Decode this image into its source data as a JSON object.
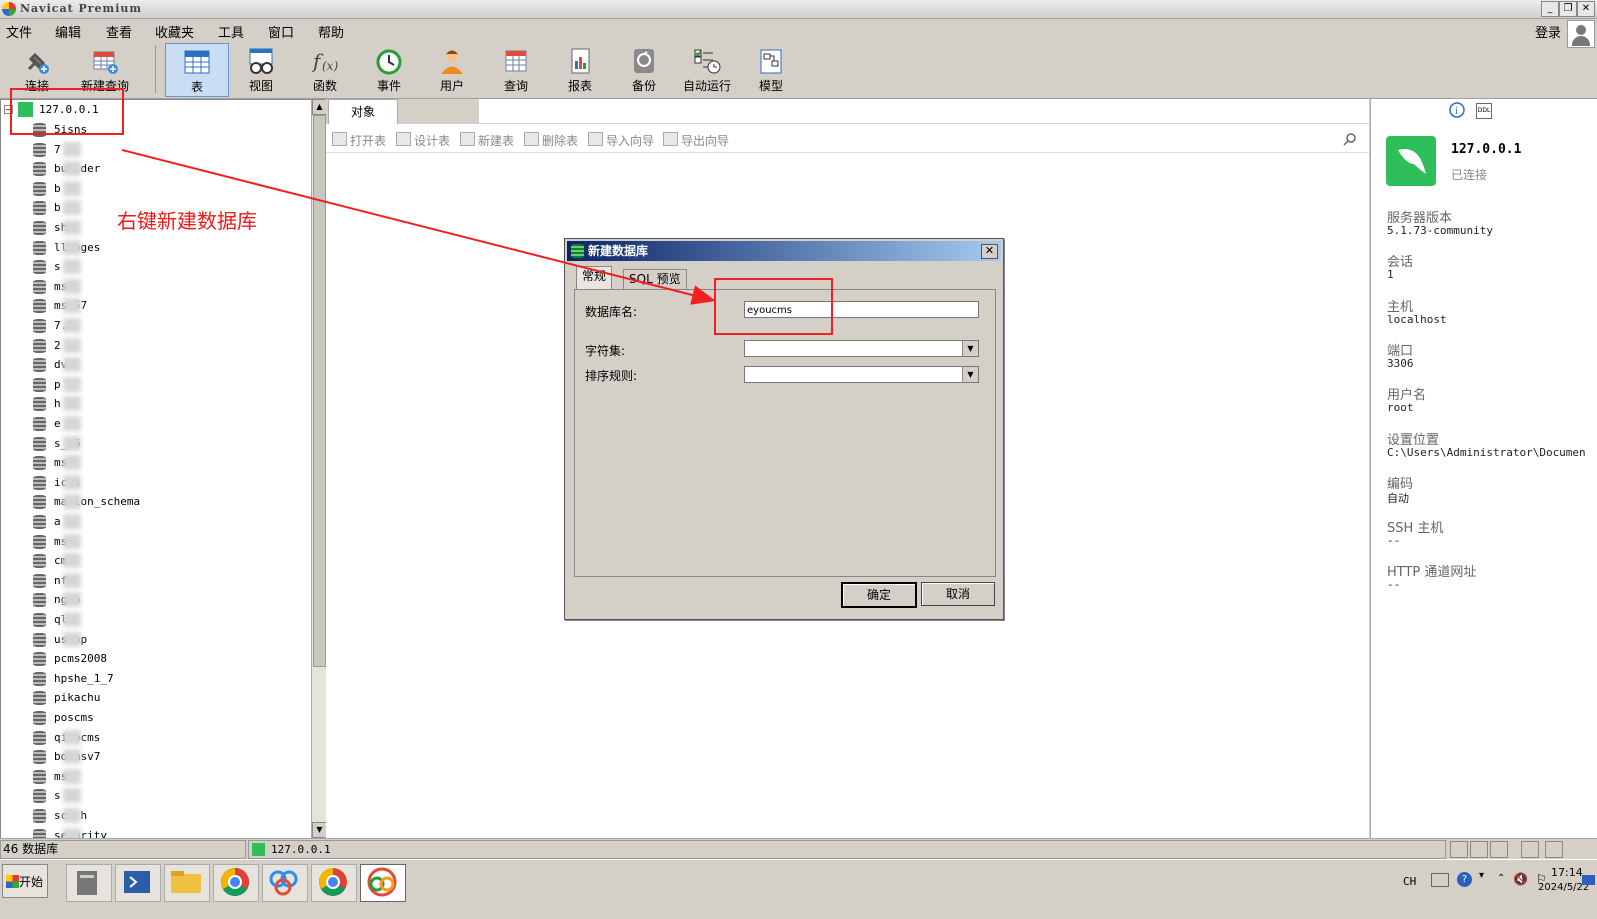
{
  "window": {
    "title": "Navicat Premium"
  },
  "menu": [
    "文件",
    "编辑",
    "查看",
    "收藏夹",
    "工具",
    "窗口",
    "帮助"
  ],
  "login_label": "登录",
  "toolbar": [
    {
      "label": "连接",
      "icon": "plug-icon"
    },
    {
      "label": "新建查询",
      "icon": "new-query-icon"
    },
    {
      "label": "表",
      "icon": "table-icon"
    },
    {
      "label": "视图",
      "icon": "view-icon"
    },
    {
      "label": "函数",
      "icon": "function-icon"
    },
    {
      "label": "事件",
      "icon": "clock-icon"
    },
    {
      "label": "用户",
      "icon": "user-icon"
    },
    {
      "label": "查询",
      "icon": "query-icon"
    },
    {
      "label": "报表",
      "icon": "report-icon"
    },
    {
      "label": "备份",
      "icon": "backup-icon"
    },
    {
      "label": "自动运行",
      "icon": "autorun-icon"
    },
    {
      "label": "模型",
      "icon": "model-icon"
    }
  ],
  "tree": {
    "connection": "127.0.0.1",
    "databases": [
      "5isns",
      "7",
      "builder",
      "b",
      "b",
      "sh",
      "llenges",
      "s",
      "ms",
      "msv57",
      "7.2",
      "2",
      "dvw",
      "p",
      "h",
      "e",
      "s_v6",
      "ms",
      "icms",
      "mation_schema",
      "a",
      "ms",
      "cms",
      "nfo",
      "ngfo",
      "ql",
      "ushop",
      "pcms2008",
      "hpshe_1_7",
      "pikachu",
      "poscms",
      "qibocms",
      "bocmsv7",
      "ms",
      "s",
      "scm h",
      "security"
    ]
  },
  "object_tab": "对象",
  "object_actions": [
    "打开表",
    "设计表",
    "新建表",
    "删除表",
    "导入向导",
    "导出向导"
  ],
  "annotation": "右键新建数据库",
  "dialog": {
    "title": "新建数据库",
    "tabs": [
      "常规",
      "SQL 预览"
    ],
    "db_name_label": "数据库名:",
    "db_name_value": "eyoucms",
    "charset_label": "字符集:",
    "collation_label": "排序规则:",
    "ok": "确定",
    "cancel": "取消"
  },
  "info": {
    "host_name": "127.0.0.1",
    "status": "已连接",
    "fields": [
      {
        "k": "服务器版本",
        "v": "5.1.73-community"
      },
      {
        "k": "会话",
        "v": "1"
      },
      {
        "k": "主机",
        "v": "localhost"
      },
      {
        "k": "端口",
        "v": "3306"
      },
      {
        "k": "用户名",
        "v": "root"
      },
      {
        "k": "设置位置",
        "v": "C:\\Users\\Administrator\\Documen"
      },
      {
        "k": "编码",
        "v": "自动"
      },
      {
        "k": "SSH 主机",
        "v": "--"
      },
      {
        "k": "HTTP 通道网址",
        "v": "--"
      }
    ]
  },
  "status": {
    "db_count": "46 数据库",
    "connection": "127.0.0.1"
  },
  "taskbar": {
    "start": "开始",
    "lang": "CH",
    "time": "17:14",
    "date": "2024/5/22"
  },
  "colors": {
    "annotation": "#f02020",
    "active_tool": "#c9ddf5",
    "dialog_title": "#0a246a"
  }
}
